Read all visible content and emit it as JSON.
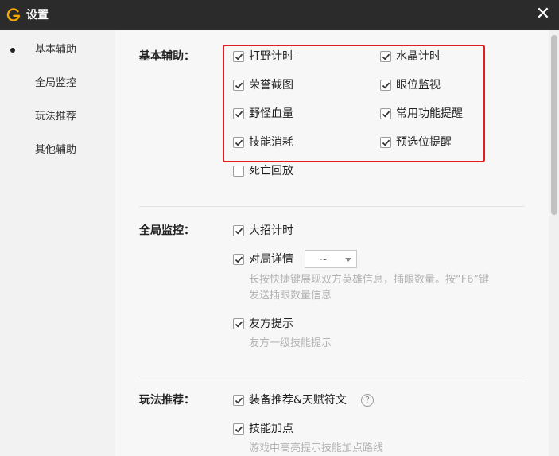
{
  "window": {
    "title": "设置",
    "close": "✕"
  },
  "sidebar": {
    "items": [
      {
        "label": "基本辅助",
        "active": true
      },
      {
        "label": "全局监控",
        "active": false
      },
      {
        "label": "玩法推荐",
        "active": false
      },
      {
        "label": "其他辅助",
        "active": false
      }
    ]
  },
  "basic": {
    "label": "基本辅助：",
    "options": [
      {
        "label": "打野计时",
        "checked": true
      },
      {
        "label": "水晶计时",
        "checked": true
      },
      {
        "label": "荣誉截图",
        "checked": true
      },
      {
        "label": "眼位监视",
        "checked": true
      },
      {
        "label": "野怪血量",
        "checked": true
      },
      {
        "label": "常用功能提醒",
        "checked": true
      },
      {
        "label": "技能消耗",
        "checked": true
      },
      {
        "label": "预选位提醒",
        "checked": true
      },
      {
        "label": "死亡回放",
        "checked": false
      }
    ]
  },
  "global": {
    "label": "全局监控：",
    "ult_timer": {
      "label": "大招计时",
      "checked": true
    },
    "match_detail": {
      "label": "对局详情",
      "checked": true,
      "dropdown_value": "~",
      "desc_line1": "长按快捷键展现双方英雄信息，插眼数量。按“F6”键",
      "desc_line2": "发送插眼数量信息"
    },
    "ally_hint": {
      "label": "友方提示",
      "checked": true,
      "desc": "友方一级技能提示"
    }
  },
  "gameplay": {
    "label": "玩法推荐：",
    "equip": {
      "label": "装备推荐&天赋符文",
      "checked": true,
      "help": "?"
    },
    "skill_points": {
      "label": "技能加点",
      "checked": true,
      "desc": "游戏中高亮提示技能加点路线"
    }
  },
  "colors": {
    "accent": "#f5a800",
    "highlight": "#e02020",
    "titlebar": "#2b2b2b"
  }
}
